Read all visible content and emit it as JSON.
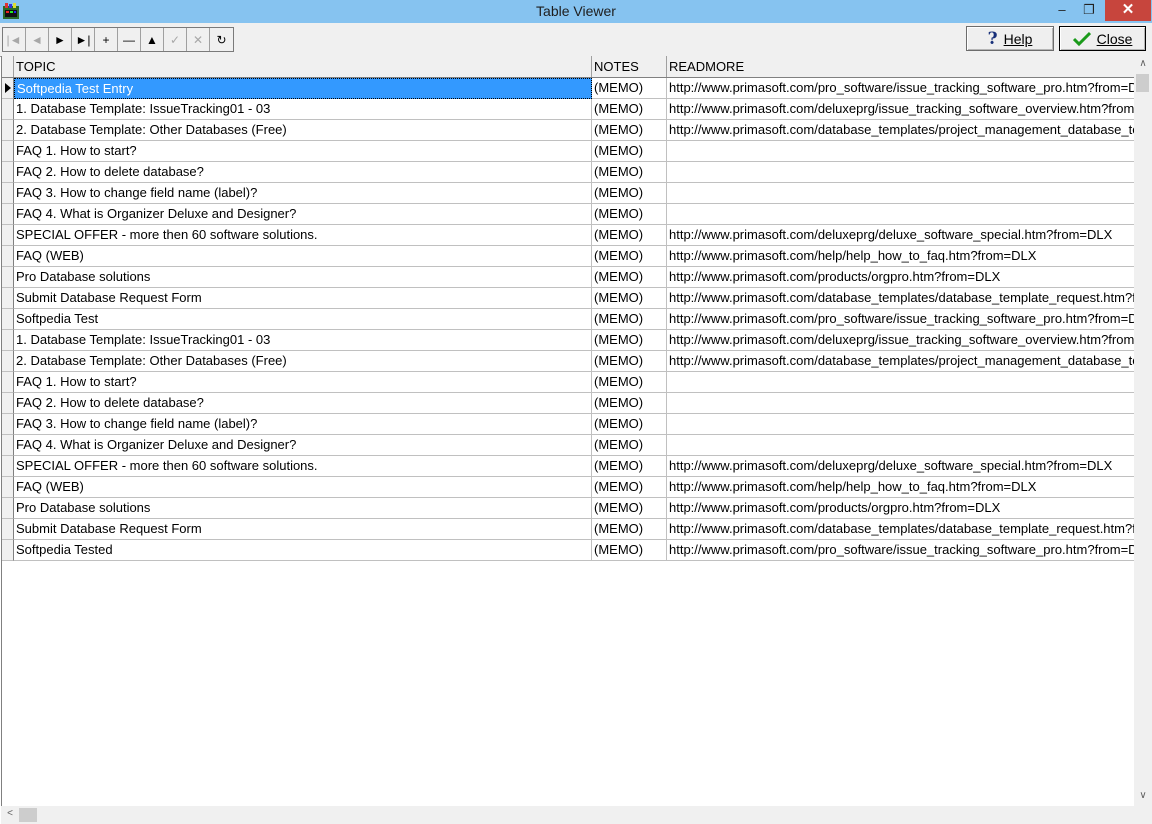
{
  "window": {
    "title": "Table Viewer",
    "minimize_glyph": "–",
    "maximize_glyph": "❐",
    "close_glyph": "✕"
  },
  "toolbar": {
    "nav_buttons": [
      {
        "glyph": "|◄",
        "icon": "first-record-icon",
        "enabled": false
      },
      {
        "glyph": "◄",
        "icon": "prior-record-icon",
        "enabled": false
      },
      {
        "glyph": "►",
        "icon": "next-record-icon",
        "enabled": true
      },
      {
        "glyph": "►|",
        "icon": "last-record-icon",
        "enabled": true
      },
      {
        "glyph": "+",
        "icon": "insert-record-icon",
        "enabled": true
      },
      {
        "glyph": "—",
        "icon": "delete-record-icon",
        "enabled": true
      },
      {
        "glyph": "▲",
        "icon": "edit-record-icon",
        "enabled": true
      },
      {
        "glyph": "✓",
        "icon": "post-record-icon",
        "enabled": false
      },
      {
        "glyph": "✕",
        "icon": "cancel-edit-icon",
        "enabled": false
      },
      {
        "glyph": "↻",
        "icon": "refresh-icon",
        "enabled": true
      }
    ],
    "help_label": "Help",
    "close_label": "Close"
  },
  "table": {
    "columns": [
      "TOPIC",
      "NOTES",
      "READMORE"
    ],
    "selected_row": 0,
    "rows": [
      [
        "Softpedia Test Entry",
        "(MEMO)",
        "http://www.primasoft.com/pro_software/issue_tracking_software_pro.htm?from=DLX"
      ],
      [
        "1. Database Template: IssueTracking01 - 03",
        "(MEMO)",
        "http://www.primasoft.com/deluxeprg/issue_tracking_software_overview.htm?from=DLX"
      ],
      [
        "2. Database Template: Other Databases (Free)",
        "(MEMO)",
        "http://www.primasoft.com/database_templates/project_management_database_templates.htm"
      ],
      [
        "FAQ 1. How to start?",
        "(MEMO)",
        ""
      ],
      [
        "FAQ 2. How to delete database?",
        "(MEMO)",
        ""
      ],
      [
        "FAQ 3. How to change field name (label)?",
        "(MEMO)",
        ""
      ],
      [
        "FAQ 4. What is Organizer Deluxe and Designer?",
        "(MEMO)",
        ""
      ],
      [
        "SPECIAL OFFER - more then 60 software solutions.",
        "(MEMO)",
        "http://www.primasoft.com/deluxeprg/deluxe_software_special.htm?from=DLX"
      ],
      [
        "FAQ (WEB)",
        "(MEMO)",
        "http://www.primasoft.com/help/help_how_to_faq.htm?from=DLX"
      ],
      [
        "Pro Database solutions",
        "(MEMO)",
        "http://www.primasoft.com/products/orgpro.htm?from=DLX"
      ],
      [
        "Submit Database Request Form",
        "(MEMO)",
        "http://www.primasoft.com/database_templates/database_template_request.htm?from=DLX"
      ],
      [
        "Softpedia Test",
        "(MEMO)",
        "http://www.primasoft.com/pro_software/issue_tracking_software_pro.htm?from=DLX"
      ],
      [
        "1. Database Template: IssueTracking01 - 03",
        "(MEMO)",
        "http://www.primasoft.com/deluxeprg/issue_tracking_software_overview.htm?from=DLX"
      ],
      [
        "2. Database Template: Other Databases (Free)",
        "(MEMO)",
        "http://www.primasoft.com/database_templates/project_management_database_templates.htm"
      ],
      [
        "FAQ 1. How to start?",
        "(MEMO)",
        ""
      ],
      [
        "FAQ 2. How to delete database?",
        "(MEMO)",
        ""
      ],
      [
        "FAQ 3. How to change field name (label)?",
        "(MEMO)",
        ""
      ],
      [
        "FAQ 4. What is Organizer Deluxe and Designer?",
        "(MEMO)",
        ""
      ],
      [
        "SPECIAL OFFER - more then 60 software solutions.",
        "(MEMO)",
        "http://www.primasoft.com/deluxeprg/deluxe_software_special.htm?from=DLX"
      ],
      [
        "FAQ (WEB)",
        "(MEMO)",
        "http://www.primasoft.com/help/help_how_to_faq.htm?from=DLX"
      ],
      [
        "Pro Database solutions",
        "(MEMO)",
        "http://www.primasoft.com/products/orgpro.htm?from=DLX"
      ],
      [
        "Submit Database Request Form",
        "(MEMO)",
        "http://www.primasoft.com/database_templates/database_template_request.htm?from=DLX"
      ],
      [
        "Softpedia Tested",
        "(MEMO)",
        "http://www.primasoft.com/pro_software/issue_tracking_software_pro.htm?from=DLX"
      ]
    ]
  },
  "colors": {
    "titlebar": "#86c3f0",
    "selection": "#3399ff",
    "close_button": "#c7453d",
    "check": "#1a9a1a"
  }
}
